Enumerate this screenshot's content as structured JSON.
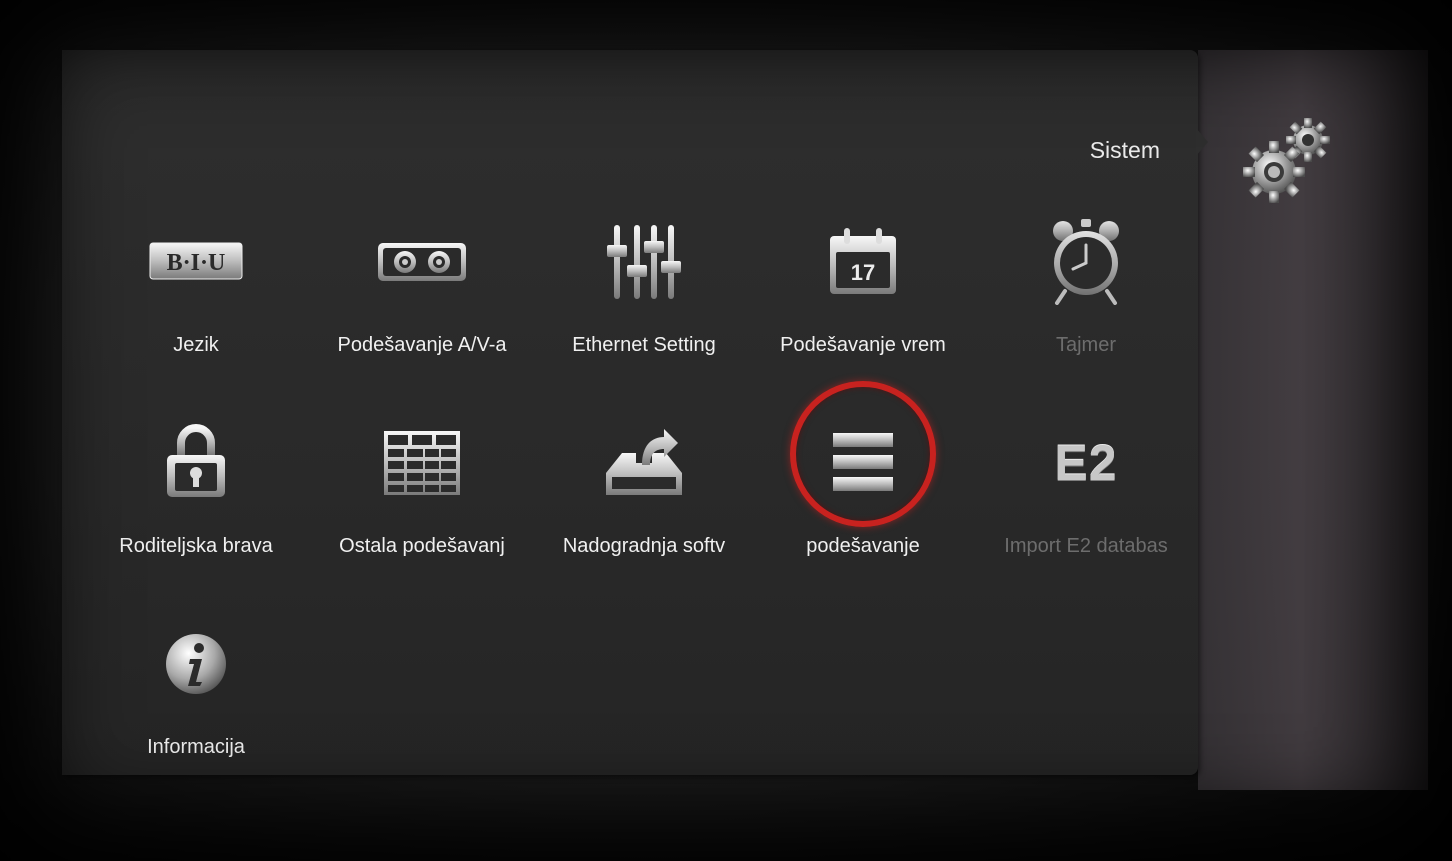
{
  "header": {
    "section_title": "Sistem",
    "section_icon": "gears-icon"
  },
  "menu": {
    "items": [
      {
        "label": "Jezik",
        "icon": "biu-text-icon",
        "enabled": true
      },
      {
        "label": "Podešavanje A/V-a",
        "icon": "av-connector-icon",
        "enabled": true
      },
      {
        "label": "Ethernet Setting",
        "icon": "sliders-icon",
        "enabled": true
      },
      {
        "label": "Podešavanje vrem",
        "icon": "calendar-icon",
        "calendar_day": "17",
        "enabled": true
      },
      {
        "label": "Tajmer",
        "icon": "alarm-clock-icon",
        "enabled": false
      },
      {
        "label": "Roditeljska brava",
        "icon": "padlock-icon",
        "enabled": true
      },
      {
        "label": "Ostala podešavanj",
        "icon": "grid-table-icon",
        "enabled": true
      },
      {
        "label": "Nadogradnja softv",
        "icon": "upgrade-tray-icon",
        "enabled": true
      },
      {
        "label": "podešavanje",
        "icon": "list-bars-icon",
        "enabled": true,
        "focused": true
      },
      {
        "label": "Import E2 databas",
        "icon": "e2-icon",
        "icon_text": "E2",
        "enabled": false
      },
      {
        "label": "Informacija",
        "icon": "info-icon",
        "enabled": true
      }
    ]
  },
  "colors": {
    "focus_ring": "#c8221f",
    "label_enabled": "#f0f0f0",
    "label_disabled": "#6d6d6d",
    "panel": "#2b2b2b"
  }
}
